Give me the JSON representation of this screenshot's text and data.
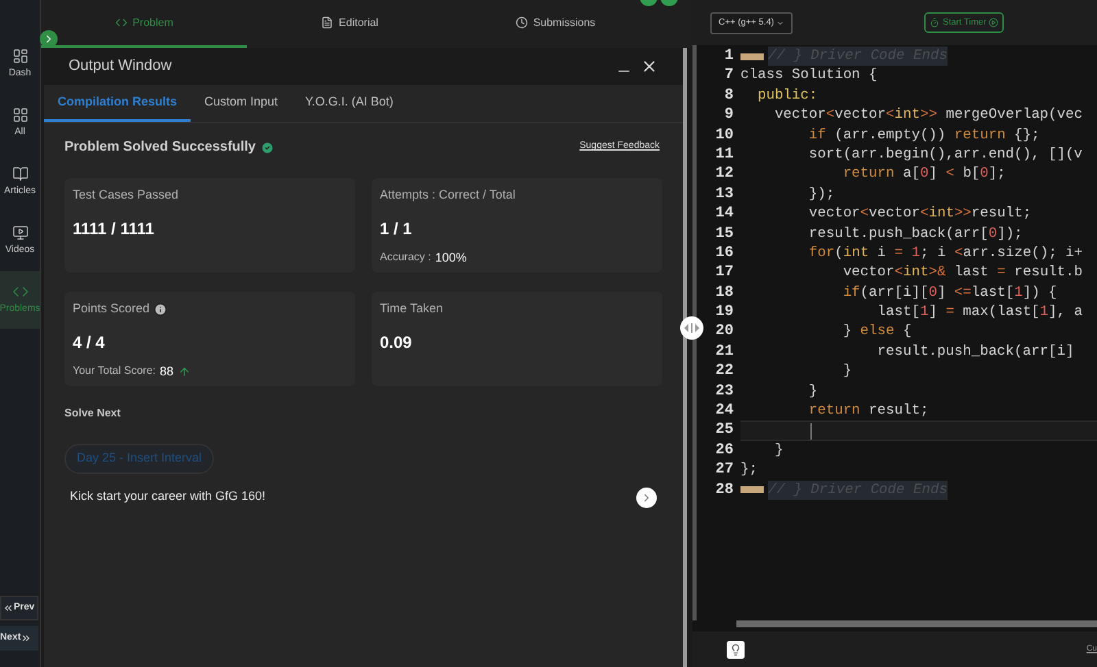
{
  "sidebar": {
    "items": [
      {
        "label": "Dash",
        "selected": false
      },
      {
        "label": "All",
        "selected": false
      },
      {
        "label": "Articles",
        "selected": false
      },
      {
        "label": "Videos",
        "selected": false
      },
      {
        "label": "Problems",
        "selected": true
      }
    ],
    "prev": "Prev",
    "next": "Next"
  },
  "top_tabs": [
    {
      "label": "Problem",
      "selected": true
    },
    {
      "label": "Editorial",
      "selected": false
    },
    {
      "label": "Submissions",
      "selected": false
    }
  ],
  "output_window": {
    "title": "Output Window",
    "tabs": [
      {
        "label": "Compilation Results",
        "selected": true
      },
      {
        "label": "Custom Input",
        "selected": false
      },
      {
        "label": "Y.O.G.I. (AI Bot)",
        "selected": false
      }
    ],
    "status": "Problem Solved Successfully",
    "feedback": "Suggest Feedback",
    "cards": [
      {
        "label": "Test Cases Passed",
        "value": "1111 / 1111"
      },
      {
        "label": "Attempts : Correct / Total",
        "value": "1 / 1",
        "note_label": "Accuracy :",
        "note_value": "100%"
      },
      {
        "label": "Points Scored",
        "kind": "score",
        "value": "4 / 4",
        "note_label": "Your Total Score:",
        "note_value": "88"
      },
      {
        "label": "Time Taken",
        "value": "0.09"
      }
    ],
    "solve_next": {
      "title": "Solve Next",
      "pill": "Day 25 - Insert Interval",
      "promo": "Kick start your career with GfG 160!"
    }
  },
  "editor": {
    "language": "C++ (g++ 5.4)",
    "timer": "Start Timer",
    "lines": [
      {
        "number": "1",
        "folded": true,
        "tokens": [
          {
            "text": "// } Driver Code Ends",
            "kind": "comment"
          }
        ]
      },
      {
        "number": "7",
        "tokens": [
          {
            "text": "class Solution {",
            "kind": "plain"
          }
        ]
      },
      {
        "number": "8",
        "tokens": [
          {
            "text": "  public:",
            "kind": "label"
          }
        ]
      },
      {
        "number": "9",
        "tokens": [
          {
            "text": "    vector",
            "kind": "plain"
          },
          {
            "text": "<",
            "kind": "punct"
          },
          {
            "text": "vector",
            "kind": "plain"
          },
          {
            "text": "<",
            "kind": "punct"
          },
          {
            "text": "int",
            "kind": "type"
          },
          {
            "text": ">>",
            "kind": "punct"
          },
          {
            "text": " mergeOverlap(vec",
            "kind": "plain"
          }
        ]
      },
      {
        "number": "10",
        "tokens": [
          {
            "text": "        if",
            "kind": "keyword"
          },
          {
            "text": " (arr.empty()) ",
            "kind": "plain"
          },
          {
            "text": "return",
            "kind": "keyword"
          },
          {
            "text": " {};",
            "kind": "plain"
          }
        ]
      },
      {
        "number": "11",
        "tokens": [
          {
            "text": "        sort(arr.begin(),arr.end(), [](v",
            "kind": "plain"
          }
        ]
      },
      {
        "number": "12",
        "tokens": [
          {
            "text": "            return",
            "kind": "keyword"
          },
          {
            "text": " a[",
            "kind": "plain"
          },
          {
            "text": "0",
            "kind": "number"
          },
          {
            "text": "] ",
            "kind": "plain"
          },
          {
            "text": "<",
            "kind": "punct"
          },
          {
            "text": " b[",
            "kind": "plain"
          },
          {
            "text": "0",
            "kind": "number"
          },
          {
            "text": "];",
            "kind": "plain"
          }
        ]
      },
      {
        "number": "13",
        "tokens": [
          {
            "text": "        });",
            "kind": "plain"
          }
        ]
      },
      {
        "number": "14",
        "tokens": [
          {
            "text": "        vector",
            "kind": "plain"
          },
          {
            "text": "<",
            "kind": "punct"
          },
          {
            "text": "vector",
            "kind": "plain"
          },
          {
            "text": "<",
            "kind": "punct"
          },
          {
            "text": "int",
            "kind": "type"
          },
          {
            "text": ">>",
            "kind": "punct"
          },
          {
            "text": "result;",
            "kind": "plain"
          }
        ]
      },
      {
        "number": "15",
        "tokens": [
          {
            "text": "        result.push_back(arr[",
            "kind": "plain"
          },
          {
            "text": "0",
            "kind": "number"
          },
          {
            "text": "]);",
            "kind": "plain"
          }
        ]
      },
      {
        "number": "16",
        "tokens": [
          {
            "text": "        for",
            "kind": "keyword"
          },
          {
            "text": "(",
            "kind": "plain"
          },
          {
            "text": "int",
            "kind": "type"
          },
          {
            "text": " i ",
            "kind": "plain"
          },
          {
            "text": "=",
            "kind": "punct"
          },
          {
            "text": " 1",
            "kind": "number"
          },
          {
            "text": "; i ",
            "kind": "plain"
          },
          {
            "text": "<",
            "kind": "punct"
          },
          {
            "text": "arr.size(); i+",
            "kind": "plain"
          }
        ]
      },
      {
        "number": "17",
        "tokens": [
          {
            "text": "            vector",
            "kind": "plain"
          },
          {
            "text": "<",
            "kind": "punct"
          },
          {
            "text": "int",
            "kind": "type"
          },
          {
            "text": ">&",
            "kind": "punct"
          },
          {
            "text": " last ",
            "kind": "plain"
          },
          {
            "text": "=",
            "kind": "punct"
          },
          {
            "text": " result.b",
            "kind": "plain"
          }
        ]
      },
      {
        "number": "18",
        "tokens": [
          {
            "text": "            if",
            "kind": "keyword"
          },
          {
            "text": "(arr[i][",
            "kind": "plain"
          },
          {
            "text": "0",
            "kind": "number"
          },
          {
            "text": "] ",
            "kind": "plain"
          },
          {
            "text": "<=",
            "kind": "punct"
          },
          {
            "text": "last[",
            "kind": "plain"
          },
          {
            "text": "1",
            "kind": "number"
          },
          {
            "text": "]) {",
            "kind": "plain"
          }
        ]
      },
      {
        "number": "19",
        "tokens": [
          {
            "text": "                last[",
            "kind": "plain"
          },
          {
            "text": "1",
            "kind": "number"
          },
          {
            "text": "] ",
            "kind": "plain"
          },
          {
            "text": "=",
            "kind": "punct"
          },
          {
            "text": " max(last[",
            "kind": "plain"
          },
          {
            "text": "1",
            "kind": "number"
          },
          {
            "text": "], a",
            "kind": "plain"
          }
        ]
      },
      {
        "number": "20",
        "tokens": [
          {
            "text": "            } ",
            "kind": "plain"
          },
          {
            "text": "else",
            "kind": "keyword"
          },
          {
            "text": " {",
            "kind": "plain"
          }
        ]
      },
      {
        "number": "21",
        "tokens": [
          {
            "text": "                result.push_back(arr[i]",
            "kind": "plain"
          }
        ]
      },
      {
        "number": "22",
        "tokens": [
          {
            "text": "            }",
            "kind": "plain"
          }
        ]
      },
      {
        "number": "23",
        "tokens": [
          {
            "text": "        }",
            "kind": "plain"
          }
        ]
      },
      {
        "number": "24",
        "tokens": [
          {
            "text": "        return",
            "kind": "keyword"
          },
          {
            "text": " result;",
            "kind": "plain"
          }
        ]
      },
      {
        "number": "25",
        "current": true
      },
      {
        "number": "26",
        "tokens": [
          {
            "text": "    }",
            "kind": "plain"
          }
        ]
      },
      {
        "number": "27",
        "tokens": [
          {
            "text": "};",
            "kind": "plain"
          }
        ]
      },
      {
        "number": "28",
        "folded": true,
        "tokens": [
          {
            "text": "// } Driver Code Ends",
            "kind": "comment"
          }
        ]
      }
    ],
    "footer_text": "Cu"
  }
}
